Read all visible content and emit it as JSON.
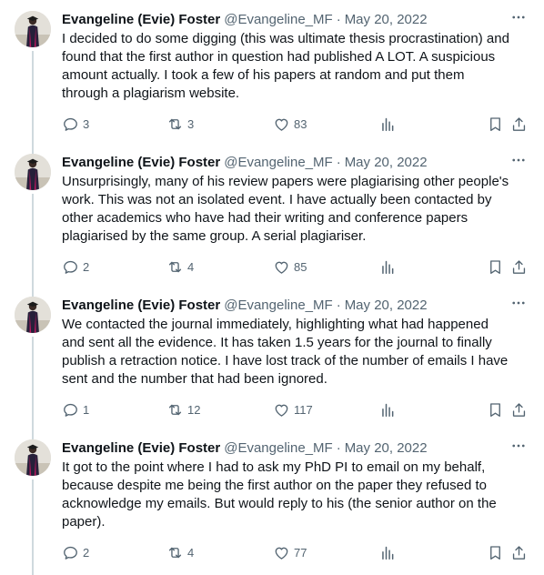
{
  "thread": {
    "tweets": [
      {
        "author_name": "Evangeline (Evie) Foster",
        "handle": "@Evangeline_MF",
        "separator": "·",
        "date": "May 20, 2022",
        "text_lines": [
          "I decided to do some digging (this was ultimate thesis procrastination) and",
          "found that the first author in question had published A LOT. A suspicious",
          "amount actually. I took a few of his papers at random and put them",
          "through a plagiarism website."
        ],
        "replies": "3",
        "reposts": "3",
        "likes": "83"
      },
      {
        "author_name": "Evangeline (Evie) Foster",
        "handle": "@Evangeline_MF",
        "separator": "·",
        "date": "May 20, 2022",
        "text_lines": [
          "Unsurprisingly, many of his review papers were plagiarising other people's",
          "work. This was not an isolated event. I have actually been contacted by",
          "other academics who have had their writing and conference papers",
          "plagiarised by the same group. A serial plagiariser."
        ],
        "replies": "2",
        "reposts": "4",
        "likes": "85"
      },
      {
        "author_name": "Evangeline (Evie) Foster",
        "handle": "@Evangeline_MF",
        "separator": "·",
        "date": "May 20, 2022",
        "text_lines": [
          "We contacted the journal immediately, highlighting what had happened",
          "and sent all the evidence. It has taken 1.5 years for the journal to finally",
          "publish a retraction notice. I have lost track of the number of emails I have",
          "sent and the number that had been ignored."
        ],
        "replies": "1",
        "reposts": "12",
        "likes": "117"
      },
      {
        "author_name": "Evangeline (Evie) Foster",
        "handle": "@Evangeline_MF",
        "separator": "·",
        "date": "May 20, 2022",
        "text_lines": [
          "It got to the point where I had to ask my PhD PI to email on my behalf,",
          "because despite me being the first author on the paper they refused to",
          "acknowledge my emails. But would reply to his (the senior author on the",
          "paper)."
        ],
        "replies": "2",
        "reposts": "4",
        "likes": "77"
      }
    ]
  },
  "icons": {
    "more": "more-horizontal-icon",
    "reply": "reply-icon",
    "repost": "repost-icon",
    "like": "heart-icon",
    "views": "views-icon",
    "bookmark": "bookmark-icon",
    "share": "share-icon"
  },
  "colors": {
    "text_primary": "#0f1419",
    "text_secondary": "#536471",
    "thread_line": "#cfd9de",
    "background": "#ffffff"
  }
}
